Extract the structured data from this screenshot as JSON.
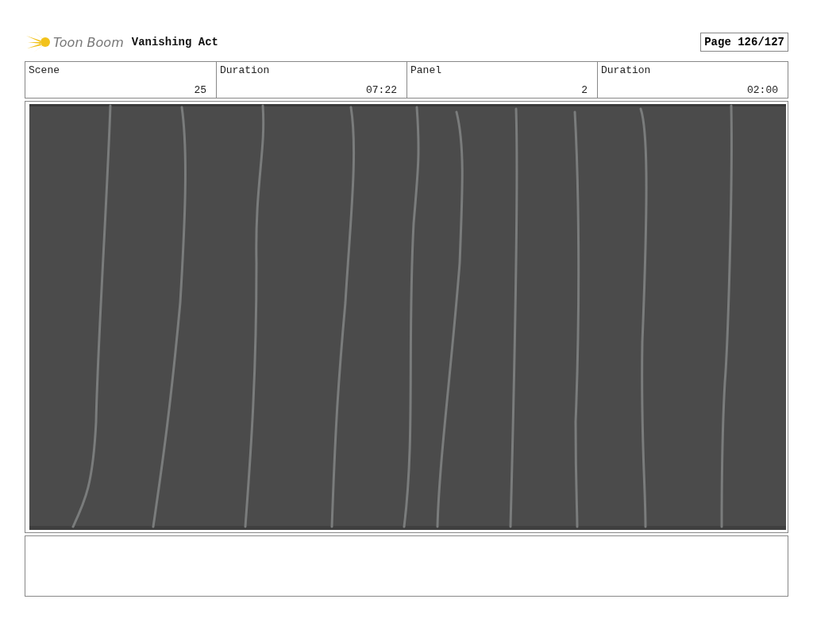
{
  "header": {
    "logo_text": "Toon Boom",
    "project_title": "Vanishing Act",
    "page": "Page 126/127"
  },
  "info": [
    {
      "label": "Scene",
      "value": "25"
    },
    {
      "label": "Duration",
      "value": "07:22"
    },
    {
      "label": "Panel",
      "value": "2"
    },
    {
      "label": "Duration",
      "value": "02:00"
    }
  ]
}
